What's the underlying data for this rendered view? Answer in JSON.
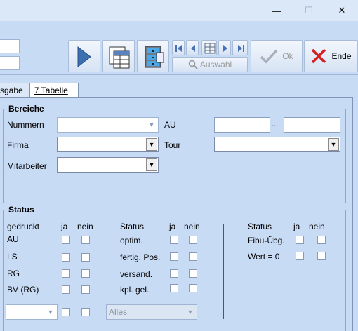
{
  "window": {
    "controls": {
      "minimize": "—",
      "maximize": "☐",
      "close": "✕"
    }
  },
  "toolbar": {
    "auswahl_label": "Auswahl",
    "ok_label": "Ok",
    "ende_label": "Ende"
  },
  "tabs": [
    {
      "label": "sgabe"
    },
    {
      "label": "7 Tabelle"
    }
  ],
  "bereiche": {
    "title": "Bereiche",
    "nummern_label": "Nummern",
    "au_label": "AU",
    "range_separator": "...",
    "firma_label": "Firma",
    "tour_label": "Tour",
    "mitarbeiter_label": "Mitarbeiter"
  },
  "status": {
    "title": "Status",
    "col1": {
      "header": "gedruckt",
      "ja": "ja",
      "nein": "nein",
      "rows": [
        "AU",
        "LS",
        "RG",
        "BV (RG)"
      ]
    },
    "col2": {
      "header": "Status",
      "ja": "ja",
      "nein": "nein",
      "rows": [
        "optim.",
        "fertig. Pos.",
        "versand.",
        "kpl. gel."
      ]
    },
    "col3": {
      "header": "Status",
      "ja": "ja",
      "nein": "nein",
      "rows": [
        "Fibu-Übg.",
        "Wert = 0"
      ]
    },
    "alles_value": "Alles"
  },
  "colors": {
    "background": "#c8dbf5",
    "titlebar": "#dbe8f8",
    "close_red": "#d42020",
    "play_blue": "#3a6fb0"
  }
}
